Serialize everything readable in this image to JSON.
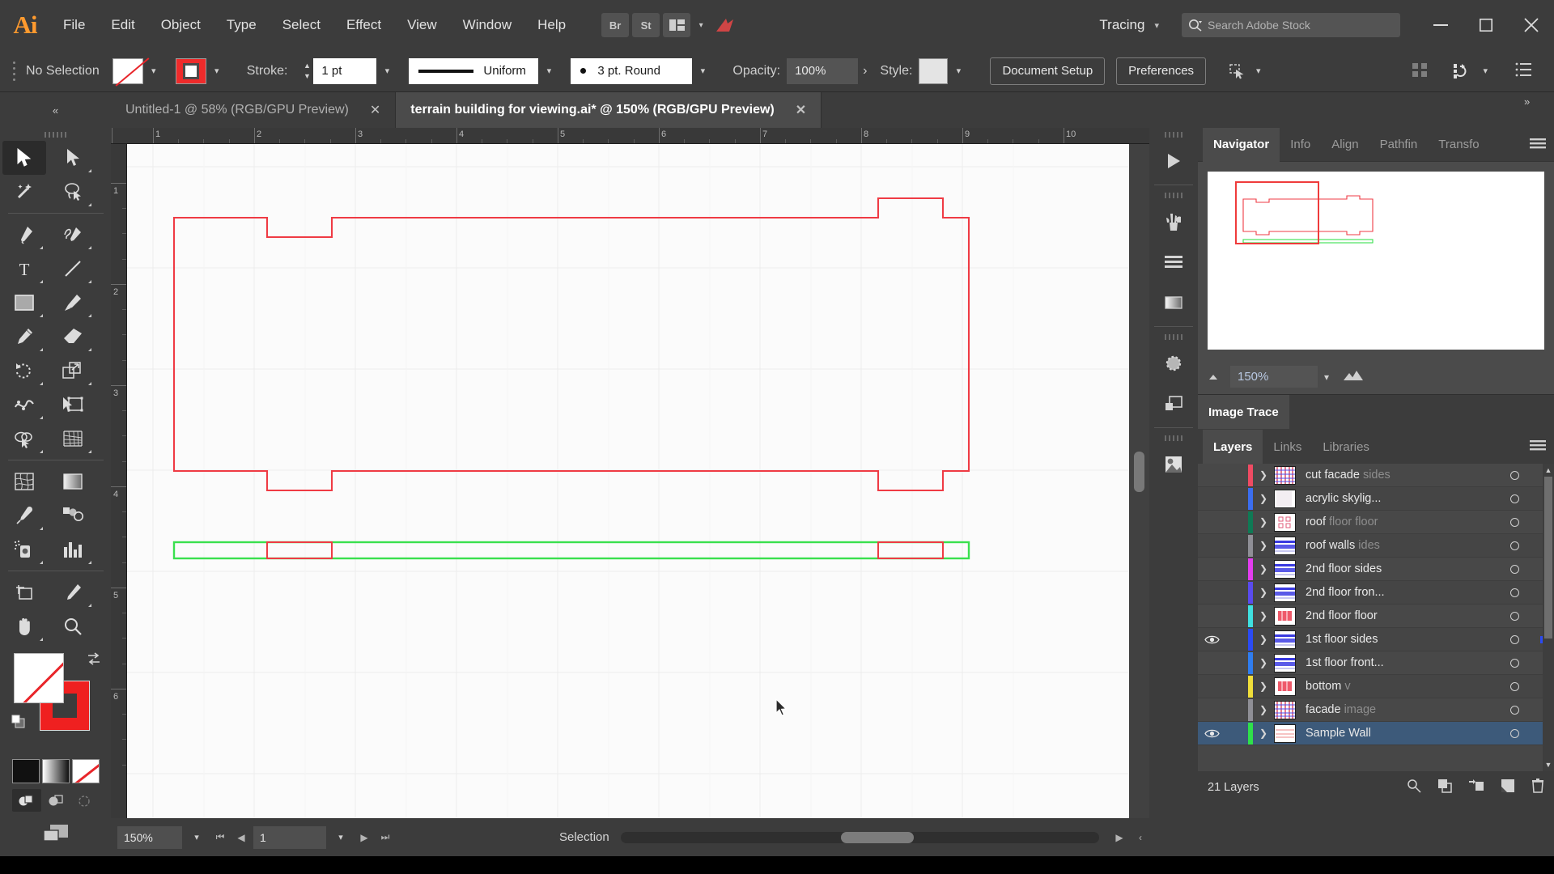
{
  "app": {
    "logo": "Ai",
    "menus": [
      "File",
      "Edit",
      "Object",
      "Type",
      "Select",
      "Effect",
      "View",
      "Window",
      "Help"
    ],
    "bridge_label": "Br",
    "stock_label": "St",
    "workspace": "Tracing",
    "search_placeholder": "Search Adobe Stock",
    "window_buttons": {
      "minimize": "–",
      "maximize": "□",
      "close": "✕"
    }
  },
  "control_bar": {
    "selection_state": "No Selection",
    "fill_swatch": "none-fill-swatch",
    "stroke_swatch": "red-stroke-swatch",
    "stroke_label": "Stroke:",
    "stroke_weight": "1 pt",
    "stroke_profile": "Uniform",
    "brush_definition": "3 pt. Round",
    "opacity_label": "Opacity:",
    "opacity_value": "100%",
    "opacity_more": "›",
    "style_label": "Style:",
    "document_setup": "Document Setup",
    "preferences": "Preferences"
  },
  "tabs": [
    {
      "title": "Untitled-1 @ 58% (RGB/GPU Preview)",
      "active": false,
      "close": "✕"
    },
    {
      "title": "terrain building for viewing.ai* @ 150% (RGB/GPU Preview)",
      "active": true,
      "close": "✕"
    }
  ],
  "collapse_left": "«",
  "collapse_right": "»",
  "tools": [
    {
      "name": "selection-tool",
      "selected": true
    },
    {
      "name": "direct-selection-tool",
      "selected": false
    },
    {
      "name": "magic-wand-tool",
      "selected": false
    },
    {
      "name": "lasso-tool",
      "selected": false
    },
    {
      "name": "pen-tool",
      "selected": false
    },
    {
      "name": "curvature-tool",
      "selected": false
    },
    {
      "name": "type-tool",
      "selected": false
    },
    {
      "name": "line-segment-tool",
      "selected": false
    },
    {
      "name": "rectangle-tool",
      "selected": false
    },
    {
      "name": "paintbrush-tool",
      "selected": false
    },
    {
      "name": "pencil-tool",
      "selected": false
    },
    {
      "name": "eraser-tool",
      "selected": false
    },
    {
      "name": "rotate-tool",
      "selected": false
    },
    {
      "name": "scale-tool",
      "selected": false
    },
    {
      "name": "width-tool",
      "selected": false
    },
    {
      "name": "free-transform-tool",
      "selected": false
    },
    {
      "name": "shape-builder-tool",
      "selected": false
    },
    {
      "name": "perspective-grid-tool",
      "selected": false
    },
    {
      "name": "mesh-tool",
      "selected": false
    },
    {
      "name": "gradient-tool",
      "selected": false
    },
    {
      "name": "eyedropper-tool",
      "selected": false
    },
    {
      "name": "blend-tool",
      "selected": false
    },
    {
      "name": "symbol-sprayer-tool",
      "selected": false
    },
    {
      "name": "column-graph-tool",
      "selected": false
    },
    {
      "name": "artboard-tool",
      "selected": false
    },
    {
      "name": "slice-tool",
      "selected": false
    },
    {
      "name": "hand-tool",
      "selected": false
    },
    {
      "name": "zoom-tool",
      "selected": false
    }
  ],
  "color_controls": {
    "fill": "None",
    "stroke": "#ef2020",
    "modes": [
      "black-color",
      "gradient",
      "none"
    ],
    "draw_modes": [
      "draw-normal",
      "draw-behind",
      "draw-inside"
    ],
    "screen_mode": "change-screen-mode"
  },
  "rulers": {
    "h_labels": [
      "1",
      "2",
      "3",
      "4",
      "5",
      "6",
      "7",
      "8",
      "9",
      "10"
    ],
    "v_labels": [
      "1",
      "2",
      "3",
      "4",
      "5",
      "6"
    ],
    "unit": "in"
  },
  "status_bar": {
    "zoom": "150%",
    "artboard": "1",
    "status": "Selection",
    "first": "⏮",
    "prev": "◀",
    "next": "▶",
    "last": "⏭"
  },
  "navigator": {
    "tabs": [
      "Navigator",
      "Info",
      "Align",
      "Pathfin",
      "Transfo"
    ],
    "active_tab": "Navigator",
    "zoom_value": "150%",
    "zoom_out_icon": "small-mountain-icon",
    "zoom_in_icon": "large-mountain-icon"
  },
  "image_trace": {
    "tab": "Image Trace"
  },
  "layers_panel": {
    "tabs": [
      "Layers",
      "Links",
      "Libraries"
    ],
    "active_tab": "Layers",
    "footer_count": "21 Layers",
    "footer_icons": [
      "locate-object-icon",
      "make-clipping-mask-icon",
      "create-new-sublayer-icon",
      "create-new-layer-icon",
      "delete-selection-icon"
    ],
    "rows": [
      {
        "name": "cut facade",
        "ghost": "sides",
        "color": "#ef4b63",
        "visible": false,
        "selected": false,
        "thumb": "grid-red"
      },
      {
        "name": "acrylic skylig...",
        "ghost": "",
        "color": "#3b6ef0",
        "visible": false,
        "selected": false,
        "thumb": "plain"
      },
      {
        "name": "roof",
        "ghost": "floor floor",
        "color": "#0f7a55",
        "visible": false,
        "selected": false,
        "thumb": "dots"
      },
      {
        "name": "roof walls",
        "ghost": "ides",
        "color": "#8f8f96",
        "visible": false,
        "selected": false,
        "thumb": "bars-blue"
      },
      {
        "name": "2nd floor sides",
        "ghost": "",
        "color": "#e43df0",
        "visible": false,
        "selected": false,
        "thumb": "bars-blue"
      },
      {
        "name": "2nd floor fron...",
        "ghost": "",
        "color": "#5a4bf0",
        "visible": false,
        "selected": false,
        "thumb": "bars-blue"
      },
      {
        "name": "2nd floor floor",
        "ghost": "",
        "color": "#3fe0e0",
        "visible": false,
        "selected": false,
        "thumb": "red-block"
      },
      {
        "name": "1st floor sides",
        "ghost": "",
        "color": "#2b4bf5",
        "visible": true,
        "selected": false,
        "thumb": "bars-blue"
      },
      {
        "name": "1st floor front...",
        "ghost": "",
        "color": "#2f7df0",
        "visible": false,
        "selected": false,
        "thumb": "bars-blue"
      },
      {
        "name": "bottom",
        "ghost": "v",
        "color": "#f0de3a",
        "visible": false,
        "selected": false,
        "thumb": "red-block"
      },
      {
        "name": "facade",
        "ghost": "image",
        "color": "#8f8f96",
        "visible": false,
        "selected": false,
        "thumb": "grid-red"
      },
      {
        "name": "Sample Wall",
        "ghost": "",
        "color": "#2fe04a",
        "visible": true,
        "selected": true,
        "thumb": "lines"
      }
    ]
  },
  "artwork": {
    "stroke_red": "#ef3b44",
    "stroke_green": "#3ae04e",
    "description": "terrain building outline with notched top and bottom edges and a green selected wall strip"
  }
}
